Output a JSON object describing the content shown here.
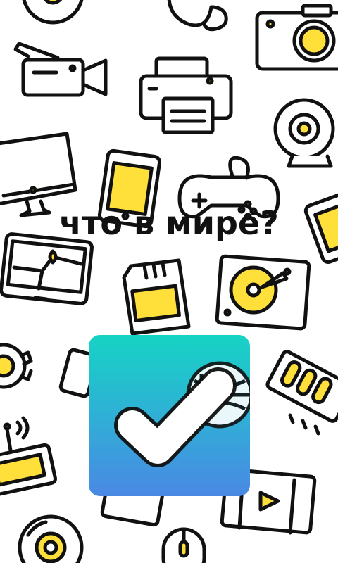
{
  "splash": {
    "title": "что в мире?"
  },
  "colors": {
    "background": "#ffffff",
    "doodle_stroke": "#111111",
    "doodle_fill": "#ffe03b",
    "logo_gradient_top": "#16d3c4",
    "logo_gradient_bottom": "#4a88e4"
  },
  "logo": {
    "icon": "checkmark-icon"
  }
}
